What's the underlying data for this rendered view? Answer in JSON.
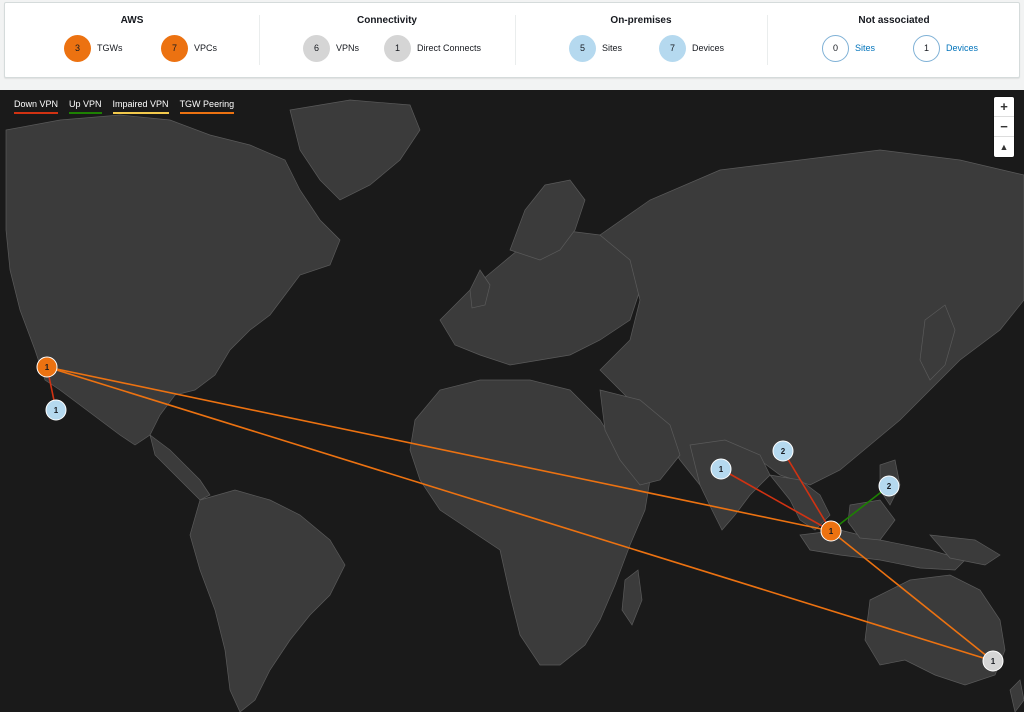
{
  "summary": {
    "aws": {
      "title": "AWS",
      "tgws": {
        "count": "3",
        "label": "TGWs"
      },
      "vpcs": {
        "count": "7",
        "label": "VPCs"
      }
    },
    "connectivity": {
      "title": "Connectivity",
      "vpns": {
        "count": "6",
        "label": "VPNs"
      },
      "direct_connects": {
        "count": "1",
        "label": "Direct Connects"
      }
    },
    "on_premises": {
      "title": "On-premises",
      "sites": {
        "count": "5",
        "label": "Sites"
      },
      "devices": {
        "count": "7",
        "label": "Devices"
      }
    },
    "not_associated": {
      "title": "Not associated",
      "sites": {
        "count": "0",
        "label": "Sites"
      },
      "devices": {
        "count": "1",
        "label": "Devices"
      }
    }
  },
  "legend": [
    {
      "label": "Down VPN",
      "color": "#d13212"
    },
    {
      "label": "Up VPN",
      "color": "#1d8102"
    },
    {
      "label": "Impaired VPN",
      "color": "#f2c94c"
    },
    {
      "label": "TGW Peering",
      "color": "#ec7211"
    }
  ],
  "zoom": {
    "in": "+",
    "out": "−",
    "reset": "▲"
  },
  "nodes": [
    {
      "id": "tgw-us-west",
      "kind": "tgw",
      "count": "1"
    },
    {
      "id": "site-us-west",
      "kind": "site",
      "count": "1"
    },
    {
      "id": "site-india",
      "kind": "site",
      "count": "1"
    },
    {
      "id": "site-myanmar",
      "kind": "site",
      "count": "2"
    },
    {
      "id": "site-philippines",
      "kind": "site",
      "count": "2"
    },
    {
      "id": "tgw-singapore",
      "kind": "tgw",
      "count": "1"
    },
    {
      "id": "device-sydney",
      "kind": "unassociated",
      "count": "1"
    }
  ],
  "colors": {
    "tgw": "#ec7211",
    "site": "#b5d9ef",
    "unassociated": "#d5d5d5",
    "map_bg": "#1a1a1a",
    "land": "#3b3b3b",
    "border": "#5a5a5a"
  }
}
